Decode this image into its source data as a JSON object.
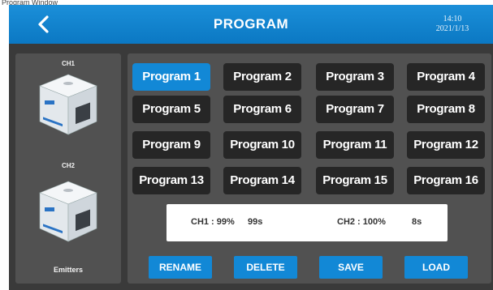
{
  "caption": "Program Window",
  "header": {
    "title": "PROGRAM",
    "time": "14:10",
    "date": "2021/1/13",
    "back_icon": "chevron-left-icon",
    "color": "#0f83cf"
  },
  "left": {
    "ch1_label": "CH1",
    "ch2_label": "CH2",
    "emitters_label": "Emitters"
  },
  "programs": [
    {
      "label": "Program 1",
      "selected": true
    },
    {
      "label": "Program 2"
    },
    {
      "label": "Program 3"
    },
    {
      "label": "Program 4"
    },
    {
      "label": "Program 5"
    },
    {
      "label": "Program 6"
    },
    {
      "label": "Program 7"
    },
    {
      "label": "Program 8"
    },
    {
      "label": "Program 9"
    },
    {
      "label": "Program 10"
    },
    {
      "label": "Program 11"
    },
    {
      "label": "Program 12"
    },
    {
      "label": "Program 13"
    },
    {
      "label": "Program 14"
    },
    {
      "label": "Program 15"
    },
    {
      "label": "Program 16"
    }
  ],
  "status": {
    "ch1": "CH1 : 99%",
    "ch1_time": "99s",
    "ch2": "CH2 : 100%",
    "ch2_time": "8s"
  },
  "actions": {
    "rename": "RENAME",
    "delete": "DELETE",
    "save": "SAVE",
    "load": "LOAD"
  },
  "colors": {
    "accent": "#1288d6",
    "button_dark": "#262626",
    "panel": "#515151",
    "background": "#3a3a3a"
  }
}
